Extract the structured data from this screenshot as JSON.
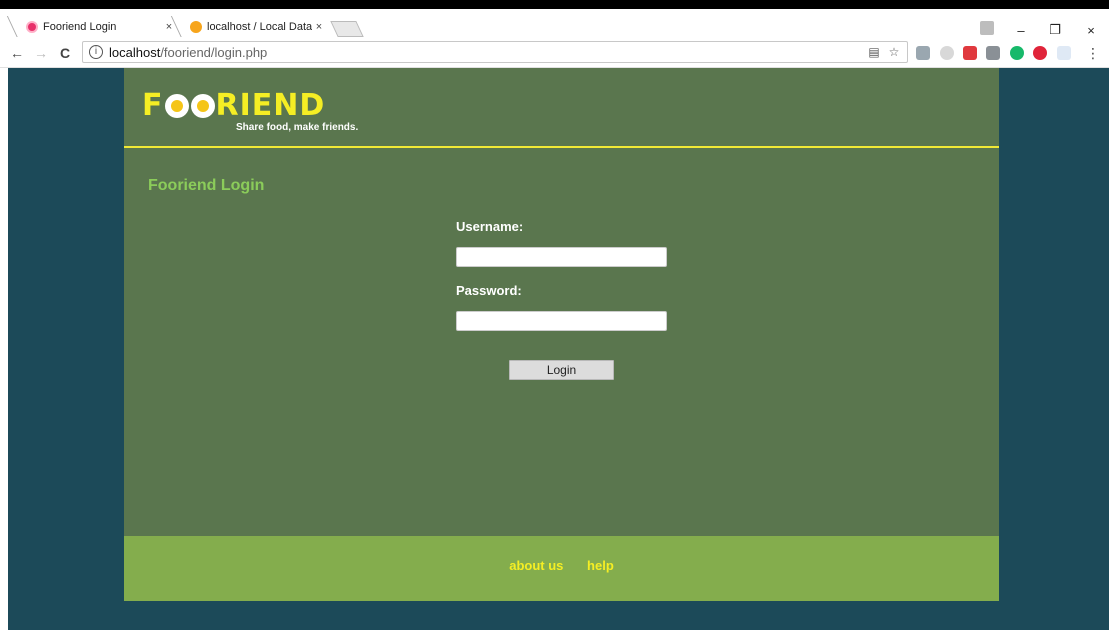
{
  "browser": {
    "tabs": [
      {
        "title": "Fooriend Login",
        "close": "×"
      },
      {
        "title": "localhost / Local Datab",
        "close": "×"
      }
    ],
    "window_controls": {
      "minimize": "–",
      "restore": "❐",
      "close": "×"
    },
    "nav": {
      "back": "←",
      "forward": "→",
      "reload": "C"
    },
    "address": {
      "info": "i",
      "host": "localhost",
      "path": "/fooriend/login.php"
    },
    "omni_icons": {
      "translate": "▤",
      "bookmark": "☆"
    }
  },
  "site": {
    "logo": {
      "part1": "F",
      "part2": "RIEND",
      "tagline": "Share food, make friends."
    },
    "login": {
      "title": "Fooriend Login",
      "username_label": "Username:",
      "password_label": "Password:",
      "username_value": "",
      "password_value": "",
      "button_label": "Login"
    },
    "footer": {
      "about": "about us",
      "help": "help"
    }
  },
  "colors": {
    "page_bg": "#1c4a59",
    "content_bg": "#5a764e",
    "footer_bg": "#84ad4d",
    "accent_yellow": "#f5ee24",
    "title_green": "#8bcc5a"
  }
}
